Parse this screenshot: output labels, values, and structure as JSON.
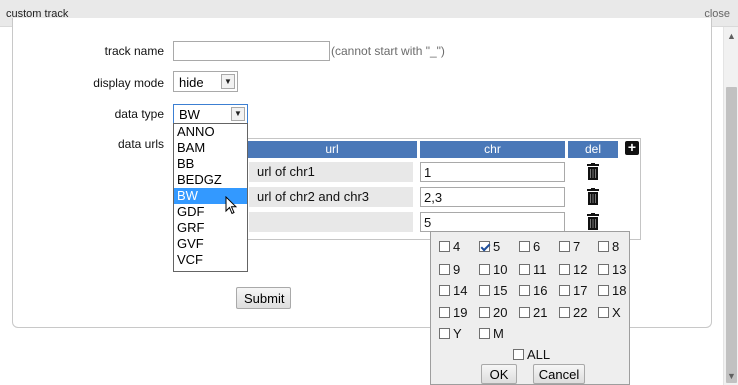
{
  "window": {
    "title": "custom track",
    "close_label": "close"
  },
  "form": {
    "track_name": {
      "label": "track name",
      "value": "",
      "placeholder": "",
      "hint": "(cannot start with \"_\")"
    },
    "display_mode": {
      "label": "display mode",
      "selected": "hide"
    },
    "data_type": {
      "label": "data type",
      "selected": "BW",
      "options": [
        "ANNO",
        "BAM",
        "BB",
        "BEDGZ",
        "BW",
        "GDF",
        "GRF",
        "GVF",
        "VCF"
      ]
    },
    "data_urls": {
      "label": "data urls",
      "headers": {
        "url": "url",
        "chr": "chr",
        "del": "del",
        "add": "+"
      },
      "rows": [
        {
          "url": "url of chr1",
          "chr": "1"
        },
        {
          "url": "url of chr2 and chr3",
          "chr": "2,3"
        },
        {
          "url": "",
          "chr": "5"
        }
      ]
    },
    "submit_label": "Submit"
  },
  "chr_picker": {
    "options": [
      {
        "label": "4",
        "checked": false
      },
      {
        "label": "5",
        "checked": true
      },
      {
        "label": "6",
        "checked": false
      },
      {
        "label": "7",
        "checked": false
      },
      {
        "label": "8",
        "checked": false
      },
      {
        "label": "9",
        "checked": false
      },
      {
        "label": "10",
        "checked": false
      },
      {
        "label": "11",
        "checked": false
      },
      {
        "label": "12",
        "checked": false
      },
      {
        "label": "13",
        "checked": false
      },
      {
        "label": "14",
        "checked": false
      },
      {
        "label": "15",
        "checked": false
      },
      {
        "label": "16",
        "checked": false
      },
      {
        "label": "17",
        "checked": false
      },
      {
        "label": "18",
        "checked": false
      },
      {
        "label": "19",
        "checked": false
      },
      {
        "label": "20",
        "checked": false
      },
      {
        "label": "21",
        "checked": false
      },
      {
        "label": "22",
        "checked": false
      },
      {
        "label": "X",
        "checked": false
      },
      {
        "label": "Y",
        "checked": false
      },
      {
        "label": "M",
        "checked": false
      }
    ],
    "all": {
      "label": "ALL",
      "checked": false
    },
    "ok_label": "OK",
    "cancel_label": "Cancel"
  },
  "colors": {
    "header_blue": "#4a78b8",
    "selection_blue": "#3399ff"
  },
  "icons": {
    "trash": "trash-icon",
    "add": "plus-icon",
    "cursor": "mouse-pointer-icon"
  }
}
